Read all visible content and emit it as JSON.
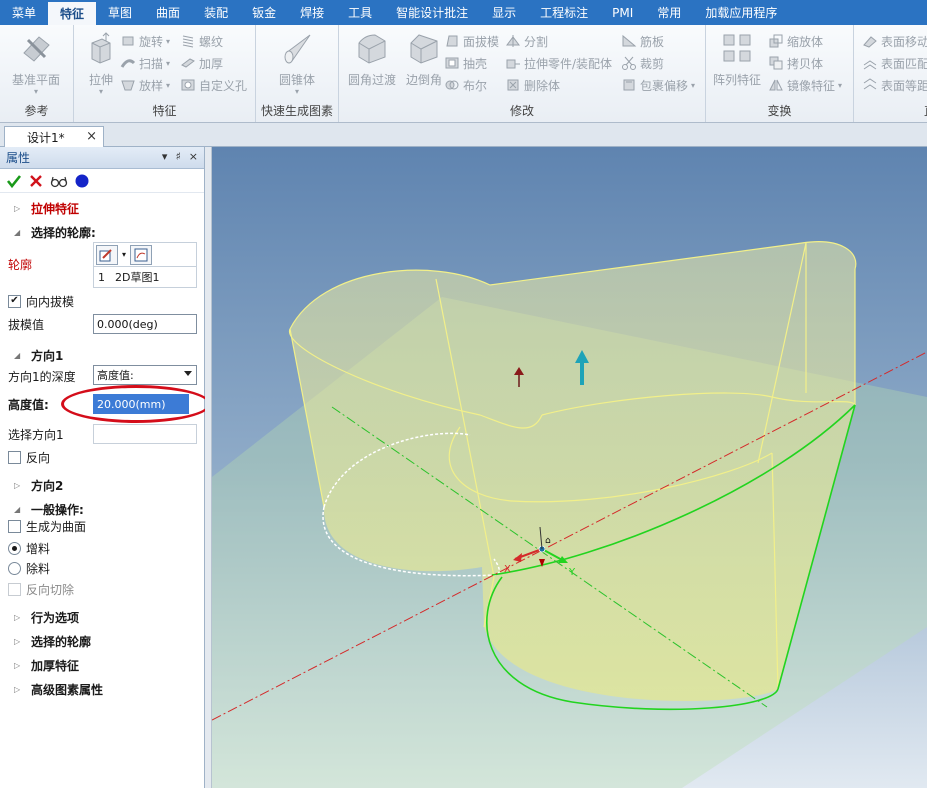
{
  "menu": {
    "tabs": [
      "菜单",
      "特征",
      "草图",
      "曲面",
      "装配",
      "钣金",
      "焊接",
      "工具",
      "智能设计批注",
      "显示",
      "工程标注",
      "PMI",
      "常用",
      "加载应用程序"
    ],
    "active_index": 1
  },
  "ribbon": {
    "groups": {
      "reference": "参考",
      "feature": "特征",
      "quick": "快速生成图素",
      "modify": "修改",
      "transform": "变换",
      "direct": "直"
    },
    "buttons": {
      "datum_plane": "基准平面",
      "extrude": "拉伸",
      "revolve": "旋转",
      "sweep": "扫描",
      "loft": "放样",
      "thread": "螺纹",
      "thicken": "加厚",
      "custom_hole": "自定义孔",
      "cone": "圆锥体",
      "fillet": "圆角过渡",
      "chamfer": "边倒角",
      "face_draft": "面拔模",
      "shell": "抽壳",
      "boolean": "布尔",
      "split": "分割",
      "extrude_to_part": "拉伸零件/装配体",
      "delete_body": "删除体",
      "rib": "筋板",
      "trim": "裁剪",
      "wrap_offset": "包裹偏移",
      "pattern": "阵列特征",
      "scale": "缩放体",
      "copy_body": "拷贝体",
      "mirror": "镜像特征",
      "face_move": "表面移动",
      "face_match": "表面匹配",
      "face_equidistant": "表面等距"
    }
  },
  "document": {
    "tab_label": "设计1*",
    "close_glyph": "×"
  },
  "panel": {
    "title": "属性",
    "title_icons": [
      "▾",
      "♯",
      "×"
    ],
    "extrude_feature": "拉伸特征",
    "selected_profile_header": "选择的轮廓:",
    "profile_label": "轮廓",
    "profile_row_index": "1",
    "profile_row_name": "2D草图1",
    "inward_draft": "向内拔模",
    "inward_draft_checked": true,
    "draft_value_label": "拔模值",
    "draft_value": "0.000(deg)",
    "direction1": "方向1",
    "direction1_depth_label": "方向1的深度",
    "direction1_depth_option": "高度值:",
    "height_label": "高度值:",
    "height_value": "20.000(mm)",
    "select_direction1": "选择方向1",
    "reverse": "反向",
    "direction2": "方向2",
    "general_ops": "一般操作:",
    "make_surface": "生成为曲面",
    "add_material": "增料",
    "remove_material": "除料",
    "reverse_cut": "反向切除",
    "behavior_options": "行为选项",
    "selected_profile_2": "选择的轮廓",
    "thicken_feature": "加厚特征",
    "advanced_props": "高级图素属性"
  },
  "viewport": {
    "axis_x": "X",
    "axis_y": "Y"
  },
  "colors": {
    "menubar": "#2b73c2",
    "confirm": "#1a9a1a",
    "cancel": "#d0121b",
    "highlight_ellipse": "#d40d1a",
    "selection": "#3c7bd6",
    "sketch_green": "#22d41f",
    "body_edge": "#f2f08a"
  }
}
